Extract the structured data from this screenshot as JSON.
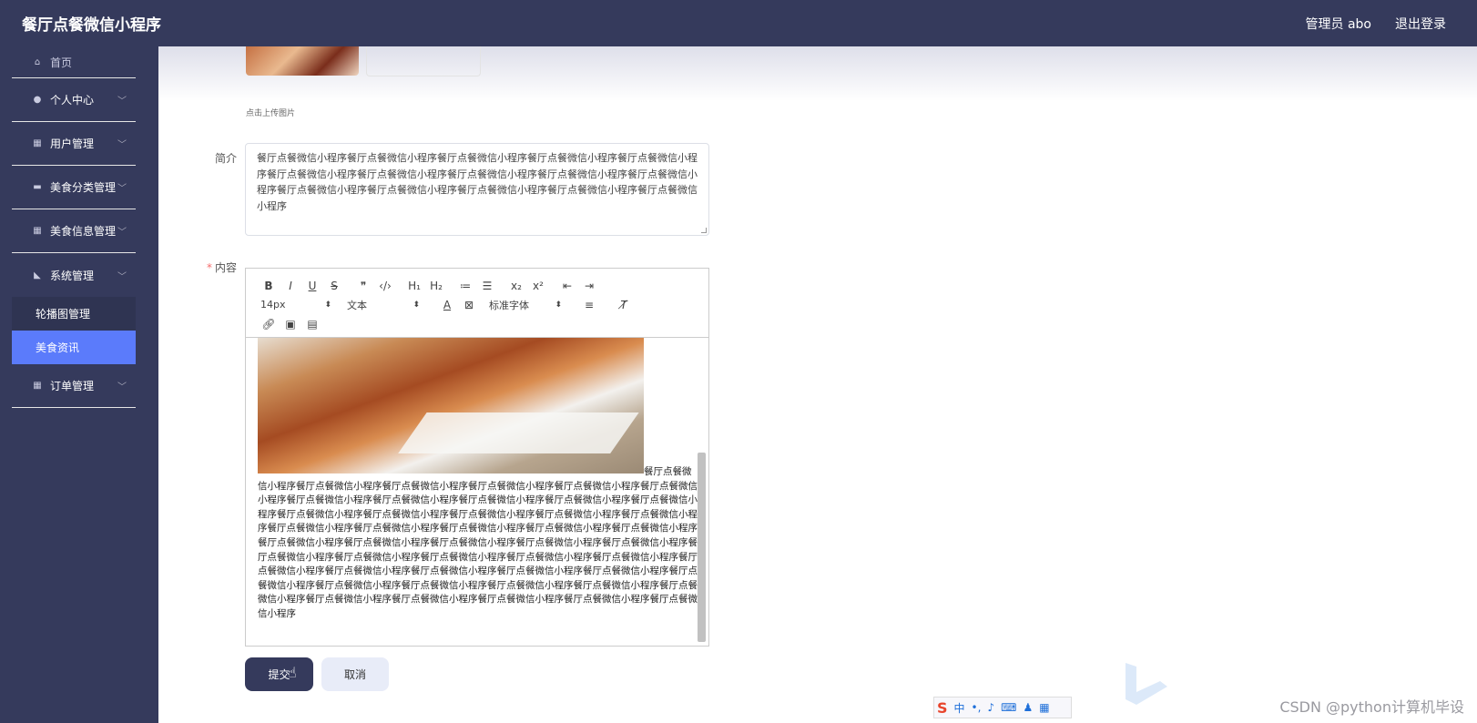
{
  "header": {
    "title": "餐厅点餐微信小程序",
    "user": "管理员 abo",
    "logout": "退出登录"
  },
  "sidebar": {
    "home": "首页",
    "items": [
      {
        "label": "个人中心",
        "icon": "user-icon"
      },
      {
        "label": "用户管理",
        "icon": "grid-icon"
      },
      {
        "label": "美食分类管理",
        "icon": "category-icon"
      },
      {
        "label": "美食信息管理",
        "icon": "grid-icon"
      },
      {
        "label": "系统管理",
        "icon": "settings-icon"
      }
    ],
    "submenu": [
      {
        "label": "轮播图管理"
      },
      {
        "label": "美食资讯",
        "active": true
      }
    ],
    "last": {
      "label": "订单管理",
      "icon": "grid-icon"
    }
  },
  "form": {
    "upload_hint": "点击上传图片",
    "intro_label": "简介",
    "intro_text": "餐厅点餐微信小程序餐厅点餐微信小程序餐厅点餐微信小程序餐厅点餐微信小程序餐厅点餐微信小程序餐厅点餐微信小程序餐厅点餐微信小程序餐厅点餐微信小程序餐厅点餐微信小程序餐厅点餐微信小程序餐厅点餐微信小程序餐厅点餐微信小程序餐厅点餐微信小程序餐厅点餐微信小程序餐厅点餐微信小程序",
    "content_label": "内容",
    "required_mark": "*",
    "toolbar": {
      "font_size": "14px",
      "block_type": "文本",
      "font_family": "标准字体"
    },
    "content_lead": "餐厅点餐微",
    "content_text": "信小程序餐厅点餐微信小程序餐厅点餐微信小程序餐厅点餐微信小程序餐厅点餐微信小程序餐厅点餐微信小程序餐厅点餐微信小程序餐厅点餐微信小程序餐厅点餐微信小程序餐厅点餐微信小程序餐厅点餐微信小程序餐厅点餐微信小程序餐厅点餐微信小程序餐厅点餐微信小程序餐厅点餐微信小程序餐厅点餐微信小程序餐厅点餐微信小程序餐厅点餐微信小程序餐厅点餐微信小程序餐厅点餐微信小程序餐厅点餐微信小程序餐厅点餐微信小程序餐厅点餐微信小程序餐厅点餐微信小程序餐厅点餐微信小程序餐厅点餐微信小程序餐厅点餐微信小程序餐厅点餐微信小程序餐厅点餐微信小程序餐厅点餐微信小程序餐厅点餐微信小程序餐厅点餐微信小程序餐厅点餐微信小程序餐厅点餐微信小程序餐厅点餐微信小程序餐厅点餐微信小程序餐厅点餐微信小程序餐厅点餐微信小程序餐厅点餐微信小程序餐厅点餐微信小程序餐厅点餐微信小程序餐厅点餐微信小程序餐厅点餐微信小程序餐厅点餐微信小程序餐厅点餐微信小程序餐厅点餐微信小程序餐厅点餐微信小程序",
    "submit": "提交",
    "cancel": "取消"
  },
  "ime": {
    "lang": "中"
  },
  "watermark": "CSDN @python计算机毕设",
  "colors": {
    "sidebar_bg": "#353a5c",
    "active_item": "#5b7bfb",
    "required": "#f56c6c"
  }
}
